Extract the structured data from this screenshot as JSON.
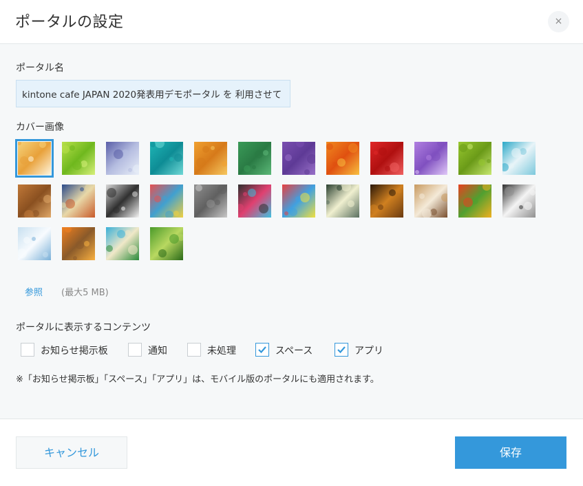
{
  "header": {
    "title": "ポータルの設定",
    "close_label": "×"
  },
  "portal_name": {
    "label": "ポータル名",
    "value": "kintone cafe JAPAN 2020発表用デモポータル を 利用させて"
  },
  "cover_image": {
    "label": "カバー画像",
    "selected_index": 0,
    "images": [
      {
        "name": "fried-food",
        "colors": [
          "#f6d27a",
          "#e8a13a",
          "#fff5dc"
        ]
      },
      {
        "name": "green-gradient",
        "colors": [
          "#b8e04a",
          "#6fb81e",
          "#d7f07a"
        ]
      },
      {
        "name": "lavender-gradient",
        "colors": [
          "#5a5ea8",
          "#b5bde0",
          "#e8eef8"
        ]
      },
      {
        "name": "teal-texture",
        "colors": [
          "#1fb6b6",
          "#0e8c95",
          "#6fd8d6"
        ]
      },
      {
        "name": "orange-texture",
        "colors": [
          "#f0a030",
          "#d67a1a",
          "#f6c860"
        ]
      },
      {
        "name": "green-texture",
        "colors": [
          "#3a9a58",
          "#2a7a44",
          "#5cb878"
        ]
      },
      {
        "name": "purple-texture",
        "colors": [
          "#7a4fb0",
          "#5e3a96",
          "#9870c8"
        ]
      },
      {
        "name": "orange-lily",
        "colors": [
          "#f08a20",
          "#e05010",
          "#f8c040"
        ]
      },
      {
        "name": "red-rose",
        "colors": [
          "#e02828",
          "#b01010",
          "#f06060"
        ]
      },
      {
        "name": "purple-flower",
        "colors": [
          "#b080e0",
          "#8050c0",
          "#e0c8f8"
        ]
      },
      {
        "name": "green-leaf",
        "colors": [
          "#98c830",
          "#6a9a18",
          "#c8e870"
        ]
      },
      {
        "name": "cubes",
        "colors": [
          "#2aa8c8",
          "#e8f4f8",
          "#7cc8dc"
        ]
      },
      {
        "name": "wood-weave",
        "colors": [
          "#c07838",
          "#8a5020",
          "#e0a868"
        ]
      },
      {
        "name": "tiles",
        "colors": [
          "#2a4a8a",
          "#e8d8a8",
          "#c85a2a"
        ]
      },
      {
        "name": "compass",
        "colors": [
          "#d8d8d8",
          "#303030",
          "#f4f4f4"
        ]
      },
      {
        "name": "notebooks",
        "colors": [
          "#e85050",
          "#40a0d0",
          "#f0d040"
        ]
      },
      {
        "name": "gears",
        "colors": [
          "#909090",
          "#606060",
          "#c8c8c8"
        ]
      },
      {
        "name": "chalk-doodles",
        "colors": [
          "#303030",
          "#e04070",
          "#40c0e0"
        ]
      },
      {
        "name": "pencils",
        "colors": [
          "#e84040",
          "#40a0e0",
          "#f0e040"
        ]
      },
      {
        "name": "lightbulb-chalk",
        "colors": [
          "#2a4030",
          "#f0f0d0",
          "#5a7060"
        ]
      },
      {
        "name": "dark-gradient",
        "colors": [
          "#2a1808",
          "#d08020",
          "#6a3a10"
        ]
      },
      {
        "name": "latte",
        "colors": [
          "#c89a60",
          "#f4ead8",
          "#7a5030"
        ]
      },
      {
        "name": "vegetables",
        "colors": [
          "#e84020",
          "#50a030",
          "#f0b020"
        ]
      },
      {
        "name": "dog",
        "colors": [
          "#303030",
          "#f4f4f4",
          "#909090"
        ]
      },
      {
        "name": "snow-trees",
        "colors": [
          "#c8e0f0",
          "#f8fbfe",
          "#7ab0d8"
        ]
      },
      {
        "name": "oranges",
        "colors": [
          "#f08020",
          "#8a5a2a",
          "#f8b040"
        ]
      },
      {
        "name": "palm-beach",
        "colors": [
          "#3ab0d8",
          "#f0e8c8",
          "#2a8a3a"
        ]
      },
      {
        "name": "bamboo",
        "colors": [
          "#4a9a2a",
          "#b8d860",
          "#2a6a18"
        ]
      }
    ],
    "browse_label": "参照",
    "max_size": "(最大5 MB)"
  },
  "contents": {
    "label": "ポータルに表示するコンテンツ",
    "options": [
      {
        "label": "お知らせ掲示板",
        "checked": false
      },
      {
        "label": "通知",
        "checked": false
      },
      {
        "label": "未処理",
        "checked": false
      },
      {
        "label": "スペース",
        "checked": true
      },
      {
        "label": "アプリ",
        "checked": true
      }
    ],
    "note": "※「お知らせ掲示板」「スペース」「アプリ」は、モバイル版のポータルにも適用されます。"
  },
  "footer": {
    "cancel_label": "キャンセル",
    "save_label": "保存"
  },
  "colors": {
    "accent": "#3498db",
    "body_bg": "#f6f8f9",
    "input_bg": "#e6f2fb"
  }
}
